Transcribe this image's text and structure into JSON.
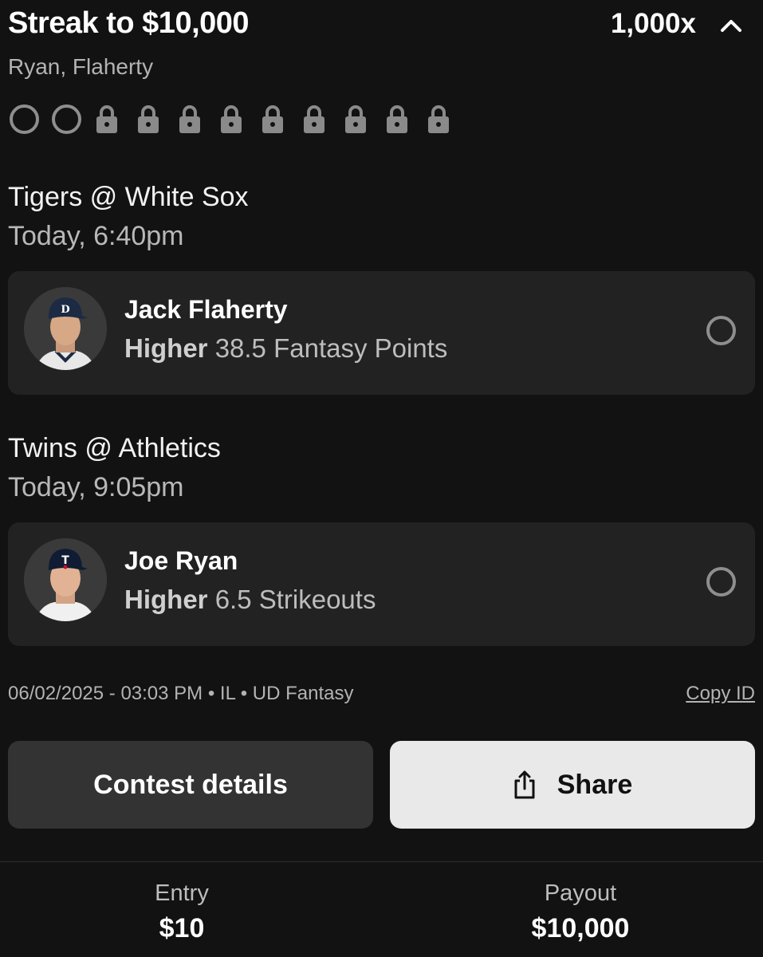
{
  "header": {
    "title": "Streak to $10,000",
    "multiplier": "1,000x",
    "collapse_icon": "chevron-up-icon",
    "players": "Ryan, Flaherty"
  },
  "progress": {
    "open_count": 2,
    "locked_count": 9,
    "open_icon": "empty-circle-icon",
    "locked_icon": "lock-icon"
  },
  "games": [
    {
      "matchup": "Tigers @ White Sox",
      "time": "Today, 6:40pm",
      "pick": {
        "player": "Jack Flaherty",
        "direction": "Higher",
        "line": "38.5 Fantasy Points",
        "status_icon": "empty-circle-icon"
      }
    },
    {
      "matchup": "Twins @ Athletics",
      "time": "Today, 9:05pm",
      "pick": {
        "player": "Joe Ryan",
        "direction": "Higher",
        "line": "6.5 Strikeouts",
        "status_icon": "empty-circle-icon"
      }
    }
  ],
  "meta": {
    "info": "06/02/2025 - 03:03 PM • IL • UD Fantasy",
    "copy_id": "Copy ID"
  },
  "buttons": {
    "details": "Contest details",
    "share": "Share",
    "share_icon": "share-icon"
  },
  "footer": {
    "entry_label": "Entry",
    "entry_value": "$10",
    "payout_label": "Payout",
    "payout_value": "$10,000"
  },
  "colors": {
    "background": "#121212",
    "card": "#222222",
    "secondary_button": "#333333",
    "primary_button": "#e9e9e9"
  }
}
